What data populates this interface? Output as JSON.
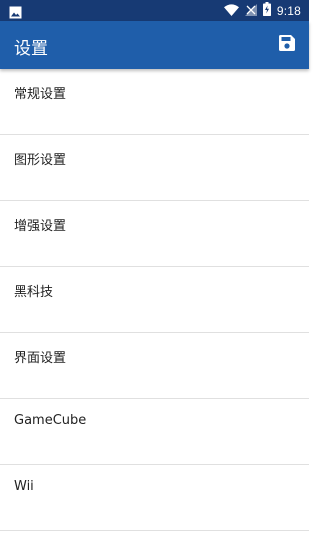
{
  "status_bar": {
    "time": "9:18",
    "icons": [
      "image-notification-icon",
      "wifi-icon",
      "signal-icon",
      "battery-charging-icon"
    ]
  },
  "app_bar": {
    "title": "设置",
    "save_icon": "save-icon"
  },
  "settings_items": [
    {
      "label": "常规设置"
    },
    {
      "label": "图形设置"
    },
    {
      "label": "增强设置"
    },
    {
      "label": "黑科技"
    },
    {
      "label": "界面设置"
    },
    {
      "label": "GameCube"
    },
    {
      "label": "Wii"
    }
  ],
  "colors": {
    "status_bar_bg": "#173a74",
    "app_bar_bg": "#1f5eaa",
    "divider": "#e0e0e0",
    "text": "#222222"
  }
}
